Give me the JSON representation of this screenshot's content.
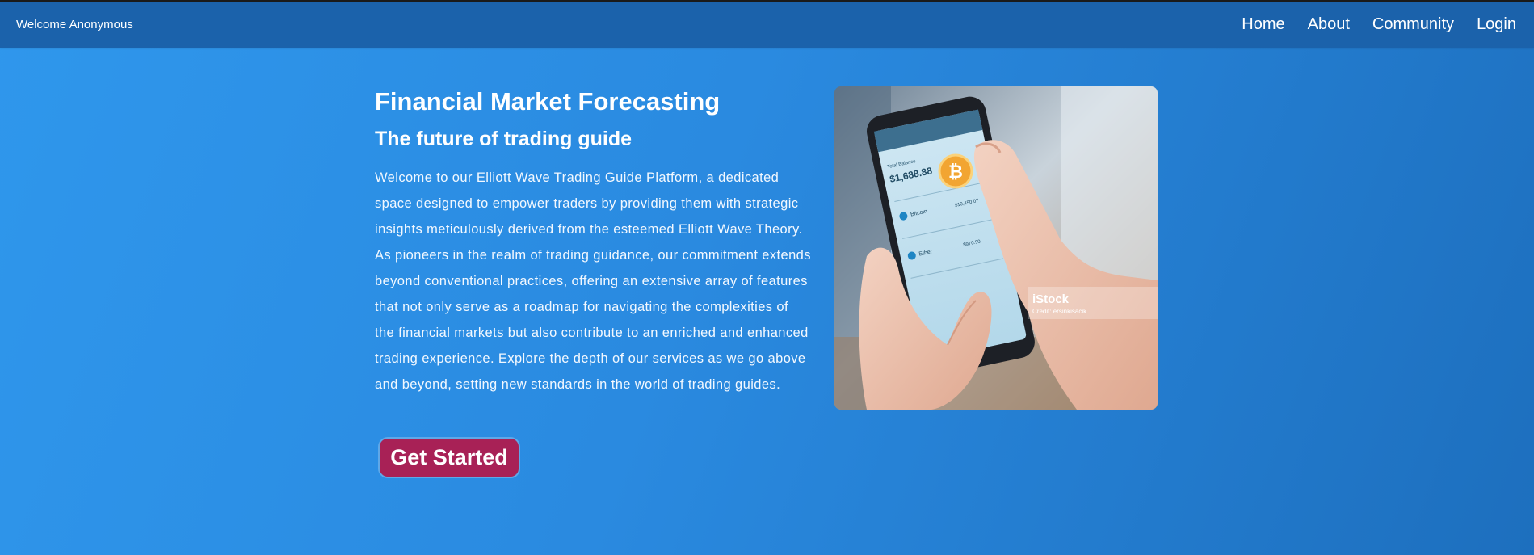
{
  "header": {
    "welcome": "Welcome Anonymous",
    "nav": [
      "Home",
      "About",
      "Community",
      "Login"
    ]
  },
  "hero": {
    "title": "Financial Market Forecasting",
    "subtitle": "The future of trading guide",
    "description": "Welcome to our Elliott Wave Trading Guide Platform, a dedicated space designed to empower traders by providing them with strategic insights meticulously derived from the esteemed Elliott Wave Theory. As pioneers in the realm of trading guidance, our commitment extends beyond conventional practices, offering an extensive array of features that not only serve as a roadmap for navigating the complexities of the financial markets but also contribute to an enriched and enhanced trading experience. Explore the depth of our services as we go above and beyond, setting new standards in the world of trading guides.",
    "cta": "Get Started"
  },
  "image": {
    "watermark": "iStock",
    "credit": "Credit: ersinkisacik",
    "phone": {
      "balance_label": "Total Balance",
      "balance": "$1,688.88",
      "coins": [
        {
          "name": "Bitcoin",
          "amount": "$10,450.07"
        },
        {
          "name": "Ether",
          "amount": "$970.90"
        }
      ]
    }
  },
  "colors": {
    "background": "#2f97ec",
    "topbar": "#1b62ab",
    "cta": "#a82156"
  }
}
